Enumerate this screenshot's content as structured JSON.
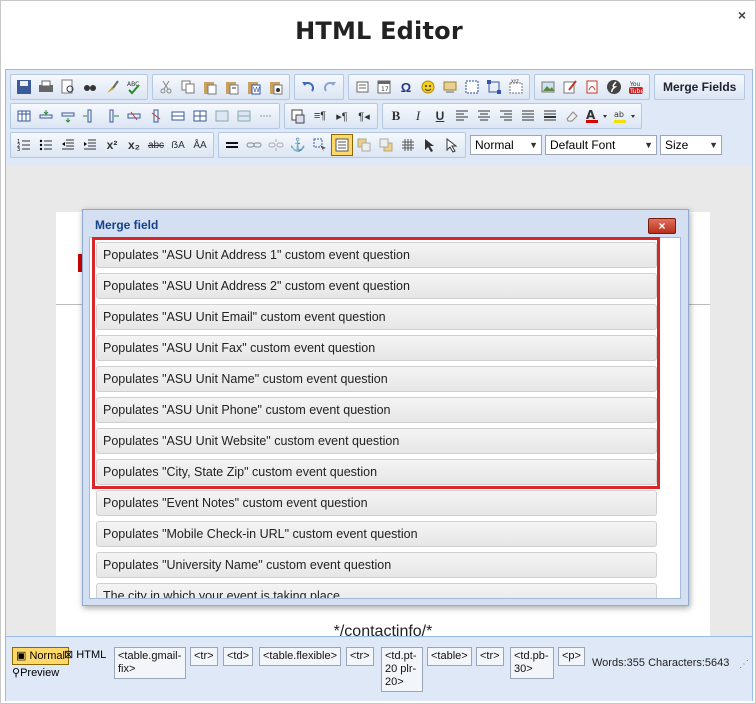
{
  "dialog": {
    "title": "HTML Editor",
    "close_glyph": "×"
  },
  "toolbar": {
    "merge_fields_label": "Merge Fields",
    "format_select": "Normal",
    "font_select": "Default Font",
    "size_select": "Size",
    "row1_icons": [
      "save-icon",
      "print-icon",
      "preview-icon",
      "find-icon",
      "clean-icon",
      "spellcheck-icon",
      "cut-icon",
      "copy-icon",
      "paste-icon",
      "paste-text-icon",
      "paste-word-icon",
      "paste-html-icon",
      "undo-icon",
      "redo-icon",
      "insert-form-icon",
      "insert-date-icon",
      "special-char-icon",
      "emoticon-icon",
      "image-map-icon",
      "show-borders-icon",
      "anchor-box-icon",
      "template-icon",
      "image-icon",
      "edit-icon",
      "pdf-icon",
      "flash-icon",
      "youtube-icon"
    ],
    "row2_icons": [
      "table-icon",
      "insert-row-above-icon",
      "insert-row-below-icon",
      "insert-col-left-icon",
      "insert-col-right-icon",
      "delete-row-icon",
      "delete-col-icon",
      "merge-cells-icon",
      "split-cells-icon",
      "cell-props-icon",
      "table-props-icon",
      "hr-small-icon",
      "rtl-icon",
      "ltr-icon",
      "paragraph-icon",
      "bold-icon",
      "italic-icon",
      "underline-icon",
      "align-left-icon",
      "align-center-icon",
      "align-right-icon",
      "justify-icon",
      "strike-format-icon",
      "eraser-icon",
      "font-color-icon",
      "highlight-color-icon"
    ],
    "row3_icons": [
      "ordered-list-icon",
      "unordered-list-icon",
      "outdent-icon",
      "indent-icon",
      "superscript-icon",
      "subscript-icon",
      "strikethrough-icon",
      "case-icon",
      "case-alt-icon",
      "horizontal-rule-icon",
      "link-icon",
      "unlink-icon",
      "anchor-icon",
      "select-icon",
      "text-box-icon",
      "shape-icon",
      "layers-icon",
      "grid-icon",
      "pointer-icon",
      "pointer-alt-icon"
    ]
  },
  "content": {
    "contact_text": "*/contactinfo/*"
  },
  "modal": {
    "title": "Merge field",
    "close_label": "×",
    "items": [
      "Populates \"ASU Unit Address 1\" custom event question",
      "Populates \"ASU Unit Address 2\" custom event question",
      "Populates \"ASU Unit Email\" custom event question",
      "Populates \"ASU Unit Fax\" custom event question",
      "Populates \"ASU Unit Name\" custom event question",
      "Populates \"ASU Unit Phone\" custom event question",
      "Populates \"ASU Unit Website\" custom event question",
      "Populates \"City, State Zip\" custom event question",
      "Populates \"Event Notes\" custom event question",
      "Populates \"Mobile Check-in URL\" custom event question",
      "Populates \"University Name\" custom event question",
      "The city in which your event is taking place"
    ]
  },
  "status": {
    "mode_normal": "Normal",
    "mode_html": "HTML",
    "mode_preview": "Preview",
    "breadcrumbs": [
      "<table.gmail-fix>",
      "<tr>",
      "<td>",
      "<table.flexible>",
      "<tr>",
      "<td.pt-20 plr-20>",
      "<table>",
      "<tr>",
      "<td.pb-30>",
      "<p>"
    ],
    "words": "Words:355",
    "characters": "Characters:5643"
  },
  "colors": {
    "highlight_border": "#d9262b",
    "active_button": "#ffd86a",
    "panel_bg": "#dfe8f6"
  }
}
